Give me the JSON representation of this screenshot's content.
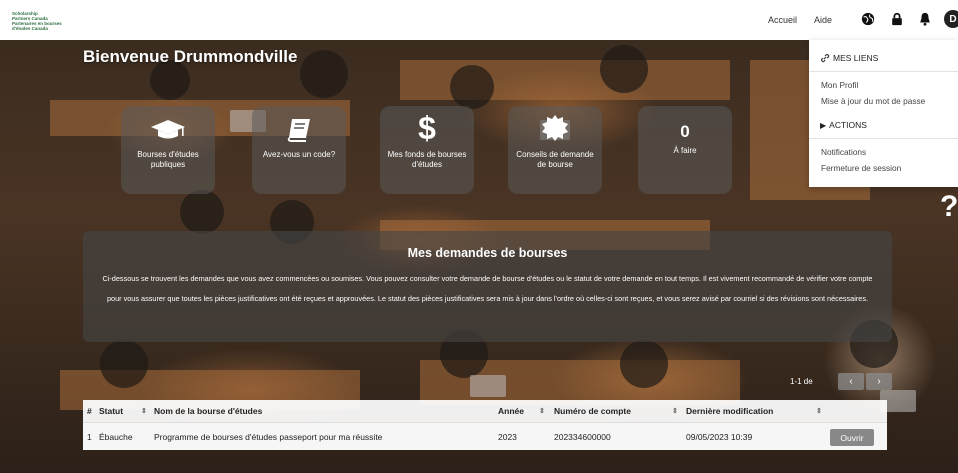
{
  "header": {
    "logo_lines": [
      "Scholarship",
      "Partners Canada",
      "Partenaires en bourses",
      "d'études Canada"
    ],
    "nav": {
      "accueil": "Accueil",
      "aide": "Aide"
    },
    "avatar_initial": "D"
  },
  "dropdown": {
    "mes_liens_title": "MES LIENS",
    "mon_profil": "Mon Profil",
    "mot_de_passe": "Mise à jour du mot de passe",
    "actions_title": "ACTIONS",
    "notifications": "Notifications",
    "fermeture": "Fermeture de session"
  },
  "welcome": "Bienvenue Drummondville",
  "tiles": [
    {
      "label": "Bourses d'études publiques",
      "icon": "graduation-cap-icon"
    },
    {
      "label": "Avez-vous un code?",
      "icon": "book-icon"
    },
    {
      "label": "Mes fonds de bourses d'études",
      "icon": "dollar-icon"
    },
    {
      "label": "Conseils de demande de bourse",
      "icon": "badge-icon"
    },
    {
      "count": "0",
      "label": "À faire"
    }
  ],
  "info": {
    "title": "Mes demandes de bourses",
    "body": "Ci-dessous se trouvent les demandes que vous avez commencées ou soumises. Vous pouvez consulter votre demande de bourse d'études ou le statut de votre demande en tout temps. Il est vivement recommandé de vérifier votre compte pour vous assurer que toutes les pièces justificatives ont été reçues et approuvées. Le statut des pièces justificatives sera mis à jour dans l'ordre où celles-ci sont reçues, et vous serez avisé par courriel si des révisions sont nécessaires."
  },
  "pager": {
    "text": "1-1 de",
    "prev": "‹",
    "next": "›"
  },
  "table": {
    "headers": [
      "#",
      "Statut",
      "Nom de la bourse d'études",
      "Année",
      "Numéro de compte",
      "Dernière modification"
    ],
    "rows": [
      {
        "num": "1",
        "statut": "Ébauche",
        "nom": "Programme de bourses d'études passeport pour ma réussite",
        "annee": "2023",
        "compte": "202334600000",
        "modif": "09/05/2023 10:39",
        "action": "Ouvrir"
      }
    ]
  },
  "help_symbol": "?",
  "colors": {
    "logo": "#2a6e3f",
    "tile_bg": "rgba(90,90,90,0.55)",
    "button": "#888888"
  }
}
